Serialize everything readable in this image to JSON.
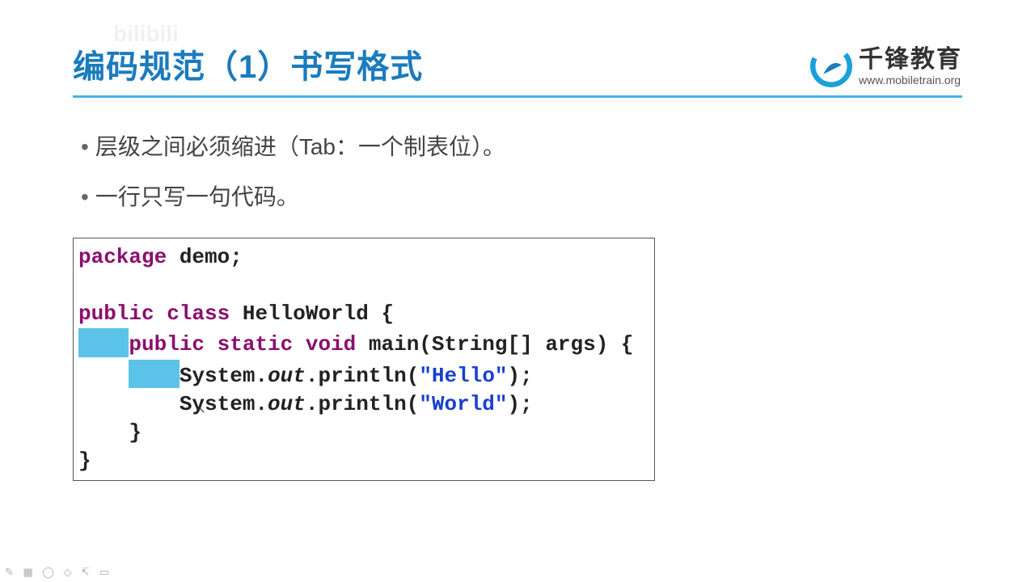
{
  "title": "编码规范（1）书写格式",
  "logo": {
    "cn": "千锋教育",
    "url": "www.mobiletrain.org"
  },
  "watermark": "bilibili",
  "bullets": [
    "层级之间必须缩进（Tab：一个制表位）。",
    "一行只写一句代码。"
  ],
  "code": {
    "line1_kw": "package",
    "line1_rest": " demo;",
    "line3_kw": "public class",
    "line3_rest": " HelloWorld {",
    "line4_pad": "    ",
    "line4_kw": "public static void",
    "line4_rest": " main(String[] args) {",
    "line5_pad1": "    ",
    "line5_pad2": "    ",
    "line5_a": "System.",
    "line5_out": "out",
    "line5_b": ".println(",
    "line5_str": "\"Hello\"",
    "line5_c": ");",
    "line6_indent": "        ",
    "line6_a": "System.",
    "line6_out": "out",
    "line6_b": ".println(",
    "line6_str": "\"World\"",
    "line6_c": ");",
    "line7": "    }",
    "line8": "}"
  }
}
